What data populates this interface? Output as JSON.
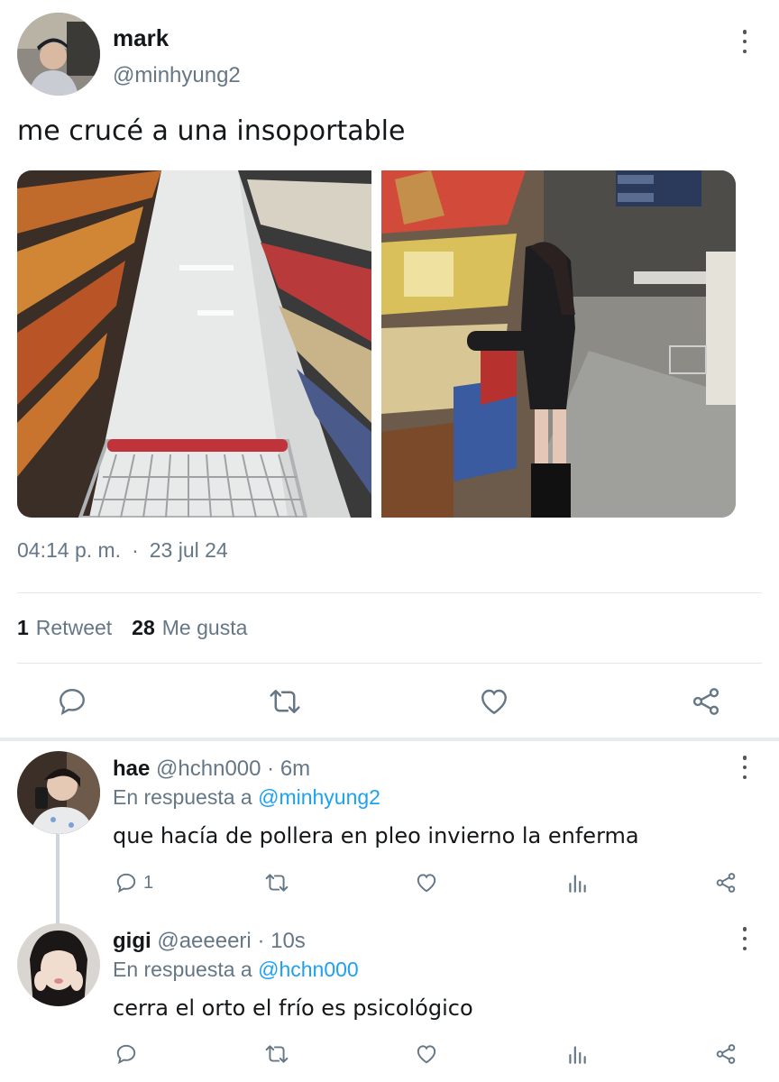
{
  "tweet": {
    "author_name": "mark",
    "author_handle": "@minhyung2",
    "text": "me crucé a una insoportable",
    "time": "04:14 p. m.",
    "separator": "·",
    "date": "23 jul 24",
    "retweet_count": "1",
    "retweet_label": "Retweet",
    "like_count": "28",
    "like_label": "Me gusta"
  },
  "replies": [
    {
      "name": "hae",
      "handle": "@hchn000",
      "time": "· 6m",
      "reply_prefix": "En respuesta a",
      "reply_to": "@minhyung2",
      "text": "que hacía de pollera en pleo invierno la enferma",
      "reply_count": "1"
    },
    {
      "name": "gigi",
      "handle": "@aeeeeri",
      "time": "· 10s",
      "reply_prefix": "En respuesta a",
      "reply_to": "@hchn000",
      "text": "cerra el orto el frío es psicológico",
      "reply_count": ""
    }
  ],
  "colors": {
    "link": "#1da1f2",
    "secondary": "#657786",
    "icon": "#657786"
  },
  "icons": [
    "more-vert-icon",
    "reply-icon",
    "retweet-icon",
    "like-icon",
    "share-icon",
    "analytics-icon"
  ]
}
